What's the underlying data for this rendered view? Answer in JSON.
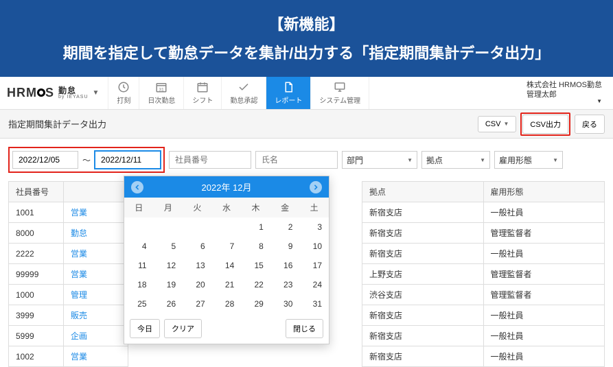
{
  "banner": {
    "title": "【新機能】",
    "subtitle": "期間を指定して勤怠データを集計/出力する「指定期間集計データ出力」"
  },
  "logo": {
    "prefix": "HRM",
    "suffix_main": "勤怠",
    "suffix_sub": "by IEYASU"
  },
  "nav": [
    {
      "label": "打刻"
    },
    {
      "label": "日次勤怠"
    },
    {
      "label": "シフト"
    },
    {
      "label": "勤怠承認"
    },
    {
      "label": "レポート"
    },
    {
      "label": "システム管理"
    }
  ],
  "user": {
    "company": "株式会社 HRMOS勤怠",
    "name": "管理太郎"
  },
  "subbar": {
    "page_title": "指定期間集計データ出力",
    "csv_menu": "CSV",
    "csv_export": "CSV出力",
    "back": "戻る"
  },
  "filters": {
    "date_from": "2022/12/05",
    "date_to": "2022/12/11",
    "emp_no_ph": "社員番号",
    "name_ph": "氏名",
    "dept": "部門",
    "site": "拠点",
    "emp_type": "雇用形態"
  },
  "tilde": "～",
  "table": {
    "headers": {
      "emp_no": "社員番号",
      "name_hidden": "",
      "site": "拠点",
      "emp_type": "雇用形態"
    },
    "rows": [
      {
        "no": "1001",
        "tag": "営業",
        "site": "新宿支店",
        "type": "一般社員"
      },
      {
        "no": "8000",
        "tag": "勤怠",
        "site": "新宿支店",
        "type": "管理監督者"
      },
      {
        "no": "2222",
        "tag": "営業",
        "site": "新宿支店",
        "type": "一般社員"
      },
      {
        "no": "99999",
        "tag": "営業",
        "site": "上野支店",
        "type": "管理監督者"
      },
      {
        "no": "1000",
        "tag": "管理",
        "site": "渋谷支店",
        "type": "管理監督者"
      },
      {
        "no": "3999",
        "tag": "販売",
        "site": "新宿支店",
        "type": "一般社員"
      },
      {
        "no": "5999",
        "tag": "企画",
        "site": "新宿支店",
        "type": "一般社員"
      },
      {
        "no": "1002",
        "tag": "営業",
        "site": "新宿支店",
        "type": "一般社員"
      }
    ]
  },
  "calendar": {
    "title": "2022年 12月",
    "dow": [
      "日",
      "月",
      "火",
      "水",
      "木",
      "金",
      "土"
    ],
    "weeks": [
      [
        "",
        "",
        "",
        "",
        "1",
        "2",
        "3"
      ],
      [
        "4",
        "5",
        "6",
        "7",
        "8",
        "9",
        "10"
      ],
      [
        "11",
        "12",
        "13",
        "14",
        "15",
        "16",
        "17"
      ],
      [
        "18",
        "19",
        "20",
        "21",
        "22",
        "23",
        "24"
      ],
      [
        "25",
        "26",
        "27",
        "28",
        "29",
        "30",
        "31"
      ]
    ],
    "today": "今日",
    "clear": "クリア",
    "close": "閉じる"
  }
}
